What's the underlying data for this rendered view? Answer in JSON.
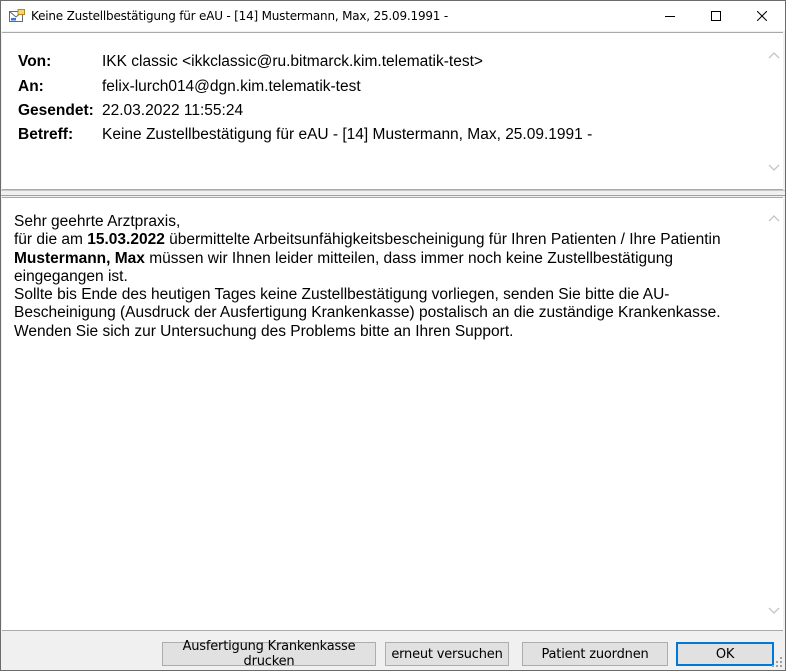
{
  "window": {
    "title": "Keine Zustellbestätigung für eAU - [14] Mustermann, Max, 25.09.1991 -"
  },
  "header": {
    "from_label": "Von:",
    "from_value": "IKK classic <ikkclassic@ru.bitmarck.kim.telematik-test>",
    "to_label": "An:",
    "to_value": "felix-lurch014@dgn.kim.telematik-test",
    "sent_label": "Gesendet:",
    "sent_value": "22.03.2022 11:55:24",
    "subject_label": "Betreff:",
    "subject_value": "Keine Zustellbestätigung für eAU - [14] Mustermann, Max, 25.09.1991 -"
  },
  "message": {
    "greeting": "Sehr geehrte Arztpraxis,",
    "line1_pre": "für die am ",
    "line1_date": "15.03.2022",
    "line1_post": " übermittelte Arbeitsunfähigkeitsbescheinigung für Ihren Patienten / Ihre Patientin",
    "patient_name": "Mustermann, Max",
    "line2_post": " müssen wir Ihnen leider mitteilen, dass immer noch keine Zustellbestätigung eingegangen ist.",
    "paragraph2": "Sollte bis Ende des heutigen Tages keine Zustellbestätigung vorliegen, senden Sie bitte die AU-Bescheinigung (Ausdruck der Ausfertigung Krankenkasse) postalisch an die zuständige Krankenkasse.",
    "paragraph3": "Wenden Sie sich zur Untersuchung des Problems bitte an Ihren Support."
  },
  "buttons": {
    "print_label": "Ausfertigung Krankenkasse drucken",
    "retry_label": "erneut versuchen",
    "assign_label": "Patient zuordnen",
    "ok_label": "OK"
  },
  "colors": {
    "accent": "#0078d7",
    "window_bg": "#f0f0f0",
    "pane_bg": "#ffffff"
  }
}
